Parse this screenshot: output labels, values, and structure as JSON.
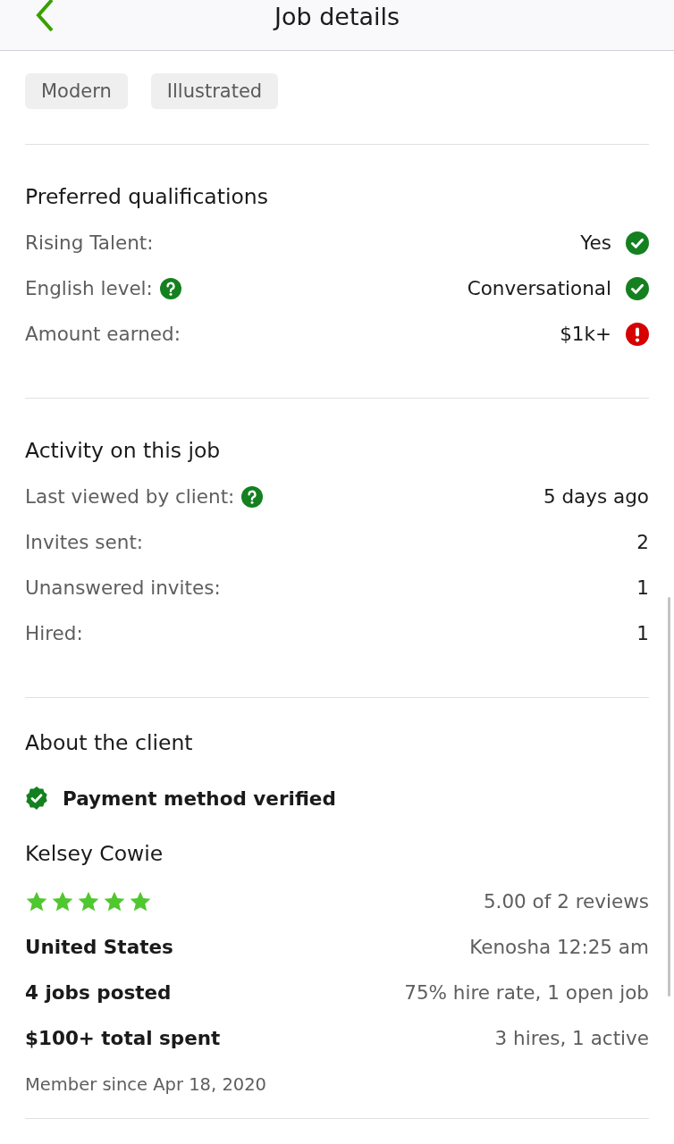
{
  "header": {
    "title": "Job details"
  },
  "tags": [
    "Modern",
    "Illustrated"
  ],
  "qualifications": {
    "title": "Preferred qualifications",
    "rows": [
      {
        "label": "Rising Talent:",
        "help": false,
        "value": "Yes",
        "met": true
      },
      {
        "label": "English level:",
        "help": true,
        "value": "Conversational",
        "met": true
      },
      {
        "label": "Amount earned:",
        "help": false,
        "value": "$1k+",
        "met": false
      }
    ]
  },
  "activity": {
    "title": "Activity on this job",
    "rows": [
      {
        "label": "Last viewed by client:",
        "help": true,
        "value": "5 days ago"
      },
      {
        "label": "Invites sent:",
        "help": false,
        "value": "2"
      },
      {
        "label": "Unanswered invites:",
        "help": false,
        "value": "1"
      },
      {
        "label": "Hired:",
        "help": false,
        "value": "1"
      }
    ]
  },
  "client": {
    "title": "About the client",
    "payment": "Payment method verified",
    "name": "Kelsey Cowie",
    "stars": 5,
    "rating": "5.00 of 2 reviews",
    "details": [
      {
        "left": "United States",
        "right": "Kenosha 12:25 am"
      },
      {
        "left": "4 jobs posted",
        "right": "75% hire rate, 1 open job"
      },
      {
        "left": "$100+ total spent",
        "right": "3 hires, 1 active"
      }
    ],
    "member_since": "Member since Apr 18, 2020"
  }
}
